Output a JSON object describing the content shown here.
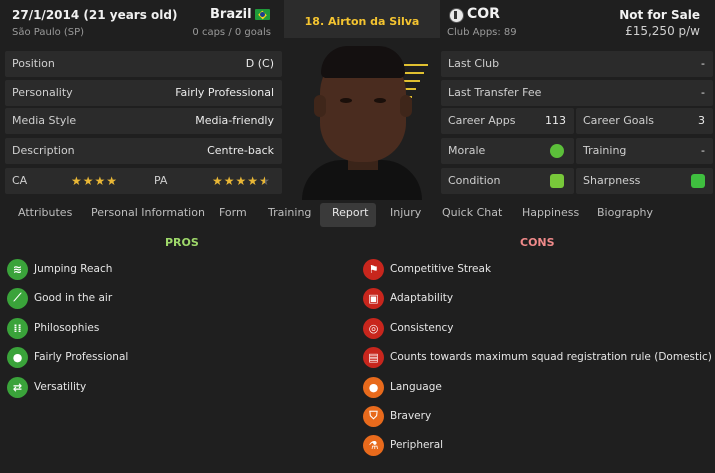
{
  "header": {
    "dob": "27/1/2014 (21 years old)",
    "birthplace": "São Paulo (SP)",
    "nation": "Brazil",
    "caps": "0 caps / 0 goals",
    "player_name": "18. Airton da Silva",
    "club": "COR",
    "club_apps": "Club Apps: 89",
    "transfer_status": "Not for Sale",
    "wage": "£15,250 p/w"
  },
  "left_rows": [
    {
      "label": "Position",
      "value": "D (C)"
    },
    {
      "label": "Personality",
      "value": "Fairly Professional"
    },
    {
      "label": "Media Style",
      "value": "Media-friendly"
    },
    {
      "label": "Description",
      "value": "Centre-back"
    }
  ],
  "ability": {
    "ca_label": "CA",
    "pa_label": "PA",
    "ca_stars": 4,
    "pa_stars": 4.5
  },
  "right_rows": {
    "last_club": {
      "label": "Last Club",
      "value": "-"
    },
    "last_fee": {
      "label": "Last Transfer Fee",
      "value": "-"
    },
    "career_apps": {
      "label": "Career Apps",
      "value": "113"
    },
    "career_goals": {
      "label": "Career Goals",
      "value": "3"
    },
    "morale": {
      "label": "Morale"
    },
    "training": {
      "label": "Training",
      "value": "-"
    },
    "condition": {
      "label": "Condition"
    },
    "sharpness": {
      "label": "Sharpness"
    }
  },
  "tabs": [
    "Attributes",
    "Personal Information",
    "Form",
    "Training",
    "Report",
    "Injury",
    "Quick Chat",
    "Happiness",
    "Biography"
  ],
  "active_tab": "Report",
  "report": {
    "pros_heading": "PROS",
    "cons_heading": "CONS",
    "pros": [
      {
        "label": "Jumping Reach",
        "icon": "spring-icon"
      },
      {
        "label": "Good in the air",
        "icon": "header-icon"
      },
      {
        "label": "Philosophies",
        "icon": "people-icon"
      },
      {
        "label": "Fairly Professional",
        "icon": "head-icon"
      },
      {
        "label": "Versatility",
        "icon": "handshake-icon"
      }
    ],
    "cons": [
      {
        "label": "Competitive Streak",
        "icon": "flag-icon"
      },
      {
        "label": "Adaptability",
        "icon": "suitcase-icon"
      },
      {
        "label": "Consistency",
        "icon": "target-icon"
      },
      {
        "label": "Counts towards maximum squad registration rule (Domestic)",
        "icon": "document-icon"
      },
      {
        "label": "Language",
        "icon": "speech-icon"
      },
      {
        "label": "Bravery",
        "icon": "shield-icon"
      },
      {
        "label": "Peripheral",
        "icon": "flask-icon"
      }
    ]
  },
  "colors": {
    "accent": "#f4c430",
    "pros": "#9ed86a",
    "cons": "#f08a8a"
  }
}
